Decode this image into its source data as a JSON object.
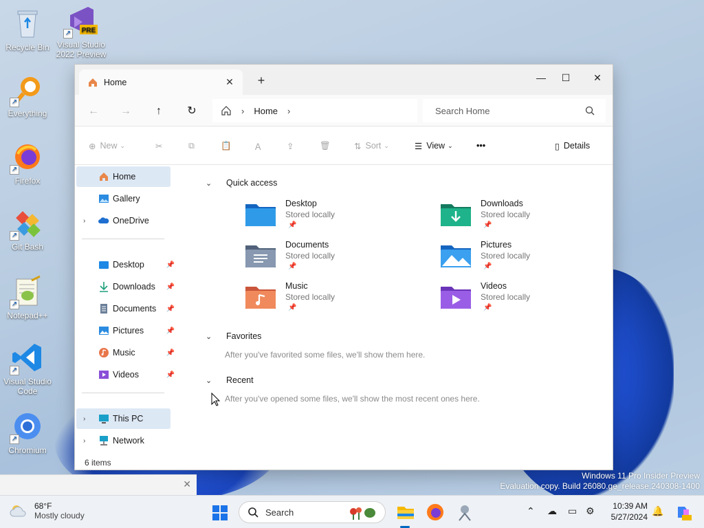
{
  "desktop": {
    "icons": [
      {
        "label": "Recycle Bin",
        "icon": "recycle-bin-icon"
      },
      {
        "label": "Visual Studio 2022 Preview",
        "icon": "visual-studio-icon",
        "badge": "PRE"
      },
      {
        "label": "Everything",
        "icon": "everything-search-icon"
      },
      {
        "label": "Firefox",
        "icon": "firefox-icon"
      },
      {
        "label": "Git Bash",
        "icon": "git-bash-icon"
      },
      {
        "label": "Notepad++",
        "icon": "notepad-plus-plus-icon"
      },
      {
        "label": "Visual Studio Code",
        "icon": "vscode-icon"
      },
      {
        "label": "Chromium",
        "icon": "chromium-icon"
      }
    ],
    "watermark_line1": "Windows 11 Pro Insider Preview",
    "watermark_line2": "Evaluation copy. Build 26080.ge_release.240308-1400"
  },
  "window": {
    "tab_title": "Home",
    "new_tab": "+",
    "controls": {
      "minimize": "—",
      "maximize": "☐",
      "close": "✕"
    },
    "breadcrumb": [
      "Home"
    ],
    "search_placeholder": "Search Home",
    "toolbar": {
      "new": "New",
      "sort": "Sort",
      "view": "View",
      "more": "•••",
      "details": "Details"
    },
    "sidebar": {
      "top": [
        {
          "label": "Home",
          "icon": "home-icon",
          "selected": true
        },
        {
          "label": "Gallery",
          "icon": "gallery-icon"
        },
        {
          "label": "OneDrive",
          "icon": "onedrive-icon",
          "expandable": true
        }
      ],
      "pinned": [
        {
          "label": "Desktop",
          "icon": "desktop-folder-icon"
        },
        {
          "label": "Downloads",
          "icon": "downloads-icon"
        },
        {
          "label": "Documents",
          "icon": "documents-icon"
        },
        {
          "label": "Pictures",
          "icon": "pictures-icon"
        },
        {
          "label": "Music",
          "icon": "music-icon"
        },
        {
          "label": "Videos",
          "icon": "videos-icon"
        }
      ],
      "bottom": [
        {
          "label": "This PC",
          "icon": "this-pc-icon",
          "selected": true
        },
        {
          "label": "Network",
          "icon": "network-icon"
        }
      ]
    },
    "sections": {
      "quick_access": "Quick access",
      "favorites": "Favorites",
      "favorites_empty": "After you've favorited some files, we'll show them here.",
      "recent": "Recent",
      "recent_empty": "After you've opened some files, we'll show the most recent ones here."
    },
    "quick_access_items": [
      {
        "name": "Desktop",
        "status": "Stored locally",
        "color": "#1e88e5"
      },
      {
        "name": "Downloads",
        "status": "Stored locally",
        "color": "#1e9e7a"
      },
      {
        "name": "Documents",
        "status": "Stored locally",
        "color": "#6b7f99"
      },
      {
        "name": "Pictures",
        "status": "Stored locally",
        "color": "#2a8be0"
      },
      {
        "name": "Music",
        "status": "Stored locally",
        "color": "#e8764a"
      },
      {
        "name": "Videos",
        "status": "Stored locally",
        "color": "#8a4fd8"
      }
    ],
    "status": "6 items"
  },
  "taskbar": {
    "weather_temp": "68°F",
    "weather_cond": "Mostly cloudy",
    "search_label": "Search",
    "time": "10:39 AM",
    "date": "5/27/2024"
  }
}
